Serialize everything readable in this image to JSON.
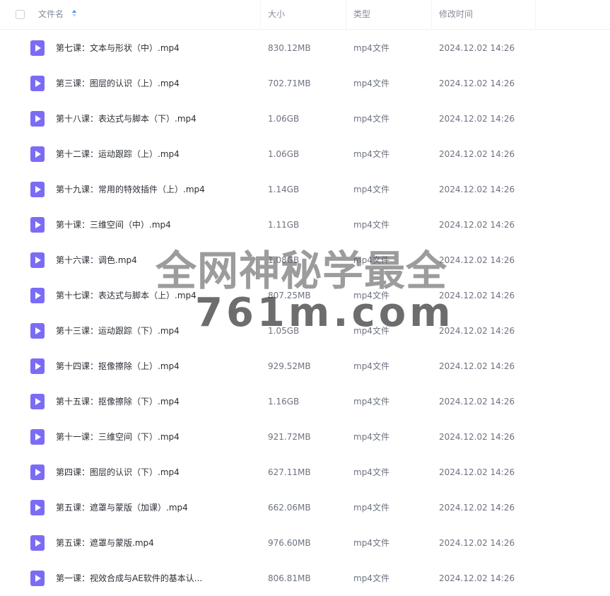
{
  "header": {
    "col_name": "文件名",
    "col_size": "大小",
    "col_type": "类型",
    "col_modified": "修改时间"
  },
  "colors": {
    "icon_purple": "#7b6cf6",
    "sort_blue": "#3f8cff"
  },
  "icons": {
    "file": "video-file-icon",
    "sort": "sort-icon"
  },
  "files": [
    {
      "name": "第七课：文本与形状（中）.mp4",
      "size": "830.12MB",
      "type": "mp4文件",
      "modified": "2024.12.02 14:26"
    },
    {
      "name": "第三课：图层的认识（上）.mp4",
      "size": "702.71MB",
      "type": "mp4文件",
      "modified": "2024.12.02 14:26"
    },
    {
      "name": "第十八课：表达式与脚本（下）.mp4",
      "size": "1.06GB",
      "type": "mp4文件",
      "modified": "2024.12.02 14:26"
    },
    {
      "name": "第十二课：运动跟踪（上）.mp4",
      "size": "1.06GB",
      "type": "mp4文件",
      "modified": "2024.12.02 14:26"
    },
    {
      "name": "第十九课：常用的特效插件（上）.mp4",
      "size": "1.14GB",
      "type": "mp4文件",
      "modified": "2024.12.02 14:26"
    },
    {
      "name": "第十课：三维空间（中）.mp4",
      "size": "1.11GB",
      "type": "mp4文件",
      "modified": "2024.12.02 14:26"
    },
    {
      "name": "第十六课：调色.mp4",
      "size": "1.08GB",
      "type": "mp4文件",
      "modified": "2024.12.02 14:26"
    },
    {
      "name": "第十七课：表达式与脚本（上）.mp4",
      "size": "807.25MB",
      "type": "mp4文件",
      "modified": "2024.12.02 14:26"
    },
    {
      "name": "第十三课：运动跟踪（下）.mp4",
      "size": "1.05GB",
      "type": "mp4文件",
      "modified": "2024.12.02 14:26"
    },
    {
      "name": "第十四课：抠像擦除（上）.mp4",
      "size": "929.52MB",
      "type": "mp4文件",
      "modified": "2024.12.02 14:26"
    },
    {
      "name": "第十五课：抠像擦除（下）.mp4",
      "size": "1.16GB",
      "type": "mp4文件",
      "modified": "2024.12.02 14:26"
    },
    {
      "name": "第十一课：三维空间（下）.mp4",
      "size": "921.72MB",
      "type": "mp4文件",
      "modified": "2024.12.02 14:26"
    },
    {
      "name": "第四课：图层的认识（下）.mp4",
      "size": "627.11MB",
      "type": "mp4文件",
      "modified": "2024.12.02 14:26"
    },
    {
      "name": "第五课：遮罩与蒙版（加课）.mp4",
      "size": "662.06MB",
      "type": "mp4文件",
      "modified": "2024.12.02 14:26"
    },
    {
      "name": "第五课：遮罩与蒙版.mp4",
      "size": "976.60MB",
      "type": "mp4文件",
      "modified": "2024.12.02 14:26"
    },
    {
      "name": "第一课：视效合成与AE软件的基本认...",
      "size": "806.81MB",
      "type": "mp4文件",
      "modified": "2024.12.02 14:26"
    }
  ],
  "watermark": {
    "line1": "全网神秘学最全",
    "line2": "761m.com"
  }
}
